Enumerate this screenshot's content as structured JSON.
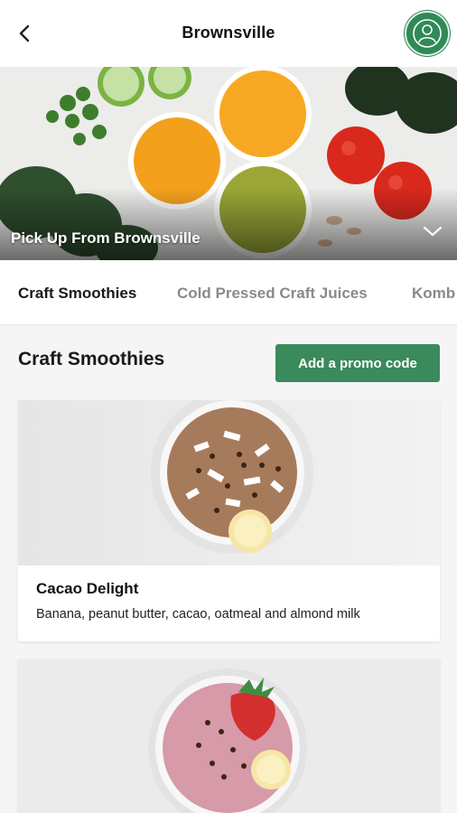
{
  "header": {
    "title": "Brownsville",
    "back_icon": "chevron-left-icon",
    "profile_icon": "user-icon",
    "brand_color": "#2f8a56"
  },
  "hero": {
    "caption": "Pick Up From Brownsville",
    "expand_icon": "chevron-down-icon"
  },
  "tabs": [
    {
      "label": "Craft Smoothies",
      "active": true
    },
    {
      "label": "Cold Pressed Craft Juices",
      "active": false
    },
    {
      "label": "Komb",
      "active": false
    }
  ],
  "section": {
    "title": "Craft Smoothies",
    "promo_label": "Add a promo code",
    "promo_color": "#3a8a5c"
  },
  "products": [
    {
      "name": "Cacao Delight",
      "description": "Banana, peanut butter, cacao, oatmeal and almond milk"
    },
    {
      "name": "",
      "description": ""
    }
  ]
}
